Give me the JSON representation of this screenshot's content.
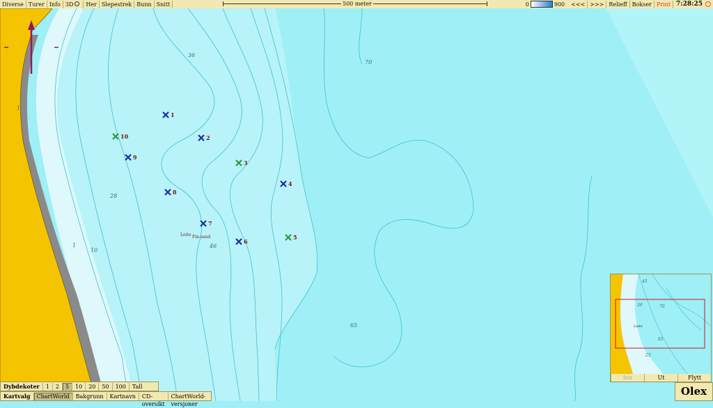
{
  "toolbar": {
    "items": [
      "Diverse",
      "Turer",
      "Info",
      "3D",
      "Her",
      "Slepestrek",
      "Bunn",
      "Snitt"
    ],
    "scale_label": "500 meter",
    "depth_min": "0",
    "depth_max": "900",
    "nav_back": "<<<",
    "nav_fwd": ">>>",
    "relieff": "Relieff",
    "bokser": "Bokser",
    "print": "Print",
    "clock": "7:28:25"
  },
  "map": {
    "colors": {
      "land": "#f5c400",
      "shallow": "#def8fb",
      "mid": "#b7f3f8",
      "deep": "#9eeff6",
      "contour": "#43c0cf",
      "markerBlue": "#1d2c9e",
      "markerGreen": "#2a9a3c"
    },
    "depth_labels": [
      "36",
      "70",
      "1",
      "28",
      "1",
      "10",
      "46",
      "65"
    ],
    "place_labels": [
      "Leite",
      "Fin.sand"
    ],
    "markers": [
      {
        "id": "1",
        "color": "blue"
      },
      {
        "id": "2",
        "color": "blue"
      },
      {
        "id": "3",
        "color": "green"
      },
      {
        "id": "4",
        "color": "blue"
      },
      {
        "id": "5",
        "color": "green"
      },
      {
        "id": "6",
        "color": "blue"
      },
      {
        "id": "7",
        "color": "blue"
      },
      {
        "id": "8",
        "color": "blue"
      },
      {
        "id": "9",
        "color": "blue"
      },
      {
        "id": "10",
        "color": "green"
      }
    ]
  },
  "dybdekoter": {
    "label": "Dybdekoter",
    "options": [
      "1",
      "2",
      "5",
      "10",
      "20",
      "50",
      "100",
      "Tall"
    ],
    "selected": "5"
  },
  "kartvalg": {
    "label": "Kartvalg",
    "options": [
      "ChartWorld",
      "Bakgrunn",
      "Kartnavn",
      "CD-oversikt",
      "ChartWorld-versjoner"
    ],
    "selected": "ChartWorld"
  },
  "minimap": {
    "labels": [
      "45",
      "36",
      "70",
      "25",
      "65",
      "Leite"
    ],
    "buttons": [
      "Inn",
      "Ut",
      "Flytt"
    ]
  },
  "brand": "Olex"
}
